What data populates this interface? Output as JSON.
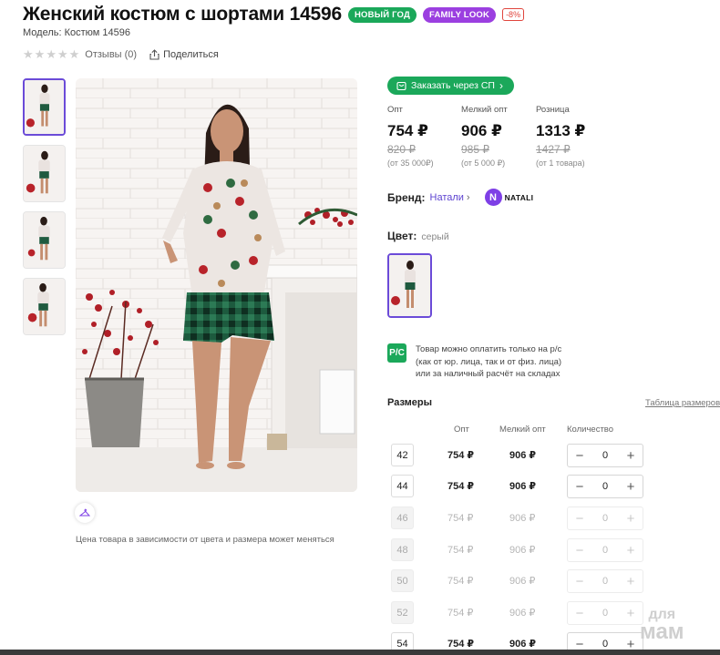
{
  "product": {
    "title": "Женский костюм с шортами 14596",
    "model": "Модель: Костюм 14596",
    "badges": [
      {
        "label": "НОВЫЙ ГОД",
        "color": "#1ba85a"
      },
      {
        "label": "FAMILY LOOK",
        "color": "#9b3fe0"
      }
    ],
    "sale_badge": "-8%",
    "rating_stars": 0,
    "reviews_label": "Отзывы (0)",
    "share_label": "Поделиться"
  },
  "gallery": {
    "thumbnail_count": 4,
    "active_index": 0,
    "note": "Цена товара в зависимости от цвета и размера может меняться"
  },
  "order_button": {
    "label": "Заказать через СП"
  },
  "prices": [
    {
      "label": "Опт",
      "value": "754 ₽",
      "old": "820 ₽",
      "note": "(от 35 000₽)"
    },
    {
      "label": "Мелкий опт",
      "value": "906 ₽",
      "old": "985 ₽",
      "note": "(от 5 000 ₽)"
    },
    {
      "label": "Розница",
      "value": "1313 ₽",
      "old": "1427 ₽",
      "note": "(от 1 товара)"
    }
  ],
  "brand": {
    "label": "Бренд:",
    "name": "Натали",
    "logo_text": "NATALI",
    "logo_letter": "N"
  },
  "color": {
    "label": "Цвет:",
    "value": "серый"
  },
  "payment": {
    "icon_text": "Р/С",
    "lines": [
      "Товар можно оплатить только на р/с",
      "(как от юр. лица, так и от физ. лица)",
      "или за наличный расчёт на складах"
    ]
  },
  "sizes": {
    "title": "Размеры",
    "table_link": "Таблица размеров",
    "headers": {
      "opt": "Опт",
      "small_opt": "Мелкий опт",
      "quantity": "Количество"
    },
    "rows": [
      {
        "size": "42",
        "opt": "754 ₽",
        "small_opt": "906 ₽",
        "qty": "0",
        "available": true
      },
      {
        "size": "44",
        "opt": "754 ₽",
        "small_opt": "906 ₽",
        "qty": "0",
        "available": true
      },
      {
        "size": "46",
        "opt": "754 ₽",
        "small_opt": "906 ₽",
        "qty": "0",
        "available": false
      },
      {
        "size": "48",
        "opt": "754 ₽",
        "small_opt": "906 ₽",
        "qty": "0",
        "available": false
      },
      {
        "size": "50",
        "opt": "754 ₽",
        "small_opt": "906 ₽",
        "qty": "0",
        "available": false
      },
      {
        "size": "52",
        "opt": "754 ₽",
        "small_opt": "906 ₽",
        "qty": "0",
        "available": false
      },
      {
        "size": "54",
        "opt": "754 ₽",
        "small_opt": "906 ₽",
        "qty": "0",
        "available": false
      }
    ]
  },
  "watermark": {
    "line1": "для",
    "line2": "мам"
  }
}
